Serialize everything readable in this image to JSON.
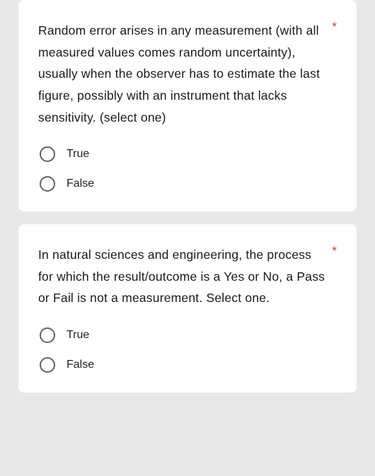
{
  "questions": [
    {
      "text": "Random error arises in any measurement (with all measured values comes random uncertainty), usually when the observer has to estimate the last figure, possibly with an instrument that lacks sensitivity. (select one)",
      "required_marker": "*",
      "options": [
        {
          "label": "True"
        },
        {
          "label": "False"
        }
      ]
    },
    {
      "text": " In natural sciences and engineering, the process for which the result/outcome is a Yes or No, a Pass or Fail is not a measurement. Select one.",
      "required_marker": "*",
      "options": [
        {
          "label": "True"
        },
        {
          "label": "False"
        }
      ]
    }
  ]
}
